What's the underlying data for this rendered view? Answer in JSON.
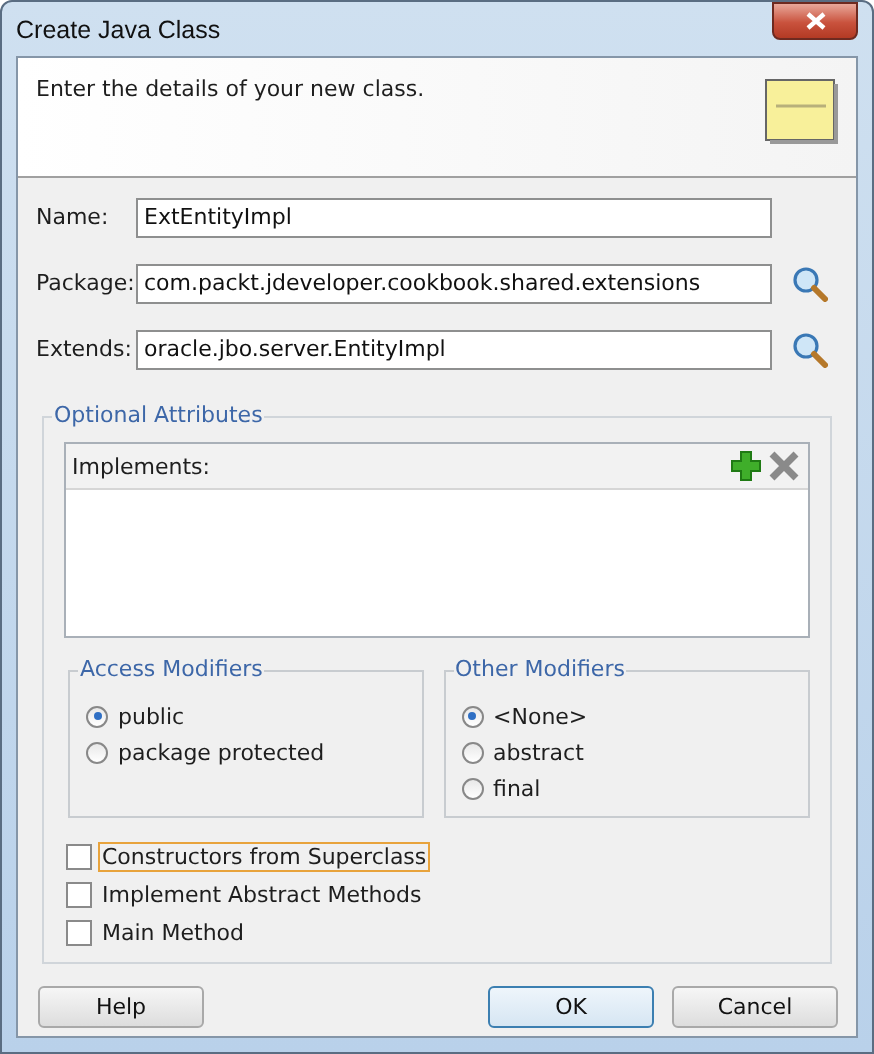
{
  "window": {
    "title": "Create Java Class"
  },
  "header": {
    "text": "Enter the details of your new class."
  },
  "fields": [
    {
      "label": "Name:",
      "value": "ExtEntityImpl",
      "browse": false
    },
    {
      "label": "Package:",
      "value": "com.packt.jdeveloper.cookbook.shared.extensions",
      "browse": true
    },
    {
      "label": "Extends:",
      "value": "oracle.jbo.server.EntityImpl",
      "browse": true
    }
  ],
  "optional_attributes": {
    "title": "Optional Attributes",
    "implements": {
      "label": "Implements:"
    },
    "groups": [
      {
        "title": "Access Modifiers",
        "options": [
          {
            "label": "public",
            "selected": true
          },
          {
            "label": "package protected",
            "selected": false
          }
        ]
      },
      {
        "title": "Other Modifiers",
        "options": [
          {
            "label": "<None>",
            "selected": true
          },
          {
            "label": "abstract",
            "selected": false
          },
          {
            "label": "final",
            "selected": false
          }
        ]
      }
    ],
    "checkboxes": [
      {
        "label": "Constructors from Superclass",
        "checked": false,
        "focused": true
      },
      {
        "label": "Implement Abstract Methods",
        "checked": false,
        "focused": false
      },
      {
        "label": "Main Method",
        "checked": false,
        "focused": false
      }
    ]
  },
  "buttons": [
    {
      "label": "Help",
      "kind": "left",
      "default": false
    },
    {
      "label": "OK",
      "kind": "right",
      "default": true
    },
    {
      "label": "Cancel",
      "kind": "right",
      "default": false
    }
  ]
}
